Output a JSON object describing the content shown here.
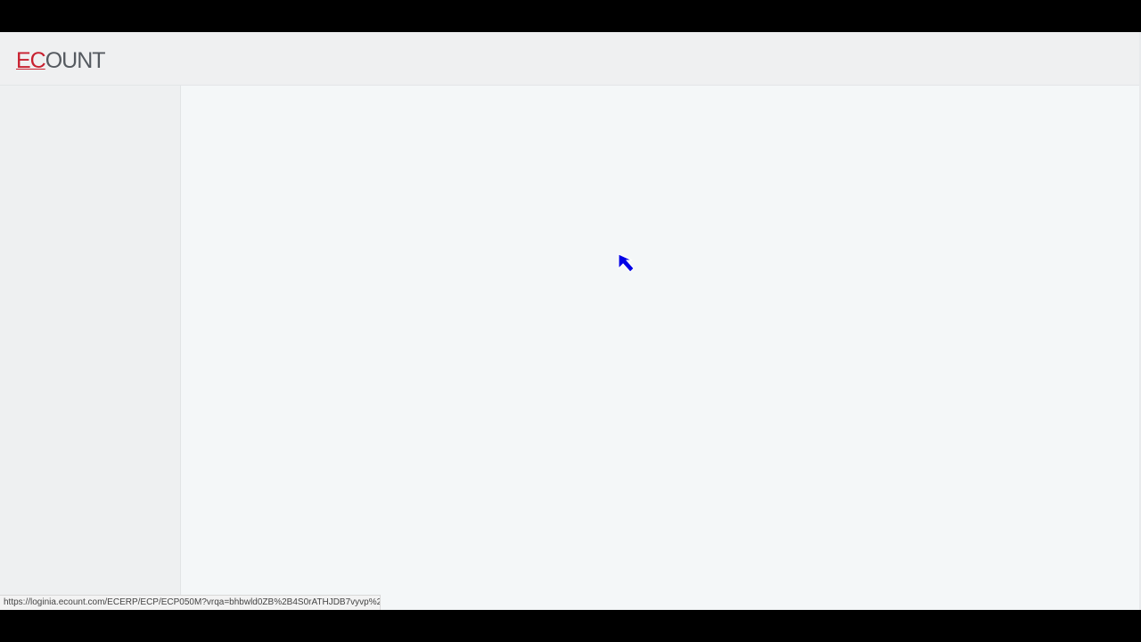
{
  "app": {
    "logo": {
      "part_a": "EC",
      "part_b": "OUNT",
      "brand_color": "#c8202f",
      "text_color": "#555a60"
    }
  },
  "status_bar": {
    "url": "https://loginia.ecount.com/ECERP/ECP/ECP050M?vrqa=bhbwld0ZB%2B4S0rATHJDB7vyvp%2..."
  },
  "cursor": {
    "icon": "arrow-cursor-icon",
    "color": "#0000e6"
  }
}
